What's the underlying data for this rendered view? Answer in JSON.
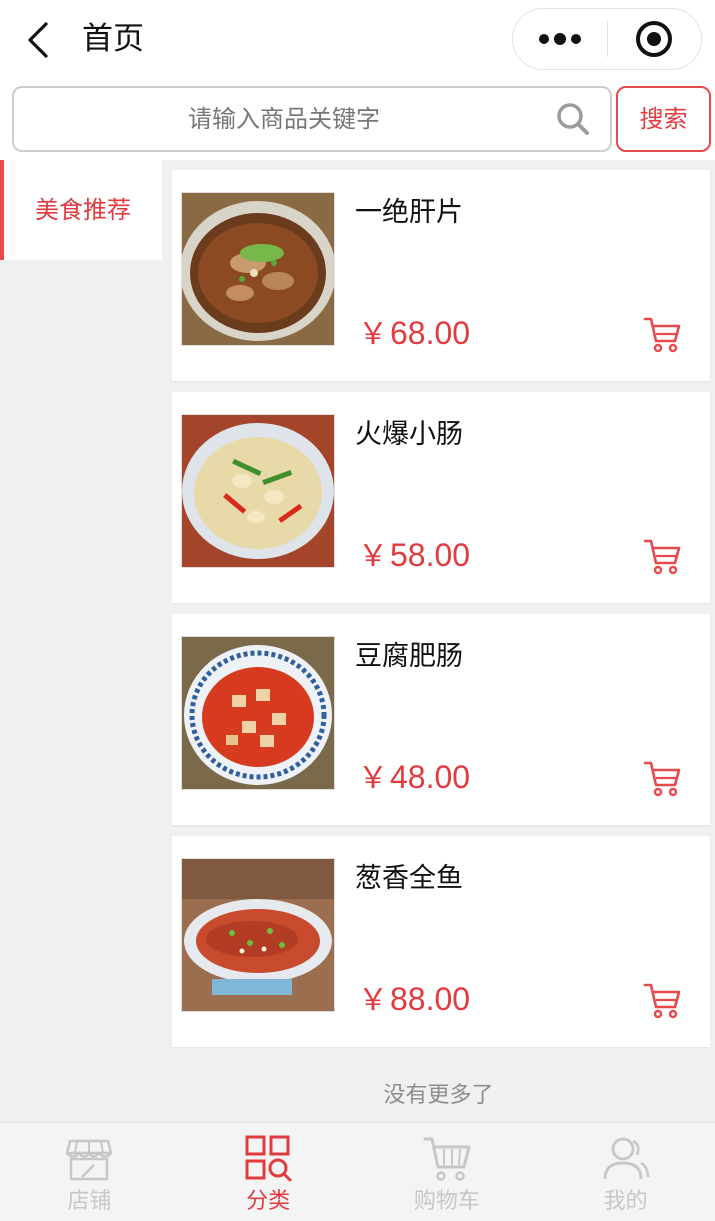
{
  "header": {
    "title": "首页",
    "back_icon": "chevron-left-icon",
    "more_icon": "more-dots-icon",
    "close_icon": "target-circle-icon"
  },
  "search": {
    "placeholder": "请输入商品关键字",
    "button_label": "搜索",
    "icon": "search-icon"
  },
  "sidebar": {
    "items": [
      {
        "label": "美食推荐",
        "active": true
      }
    ]
  },
  "products": [
    {
      "name": "一绝肝片",
      "currency": "￥",
      "price": "68.00",
      "cart_icon": "cart-icon"
    },
    {
      "name": "火爆小肠",
      "currency": "￥",
      "price": "58.00",
      "cart_icon": "cart-icon"
    },
    {
      "name": "豆腐肥肠",
      "currency": "￥",
      "price": "48.00",
      "cart_icon": "cart-icon"
    },
    {
      "name": "葱香全鱼",
      "currency": "￥",
      "price": "88.00",
      "cart_icon": "cart-icon"
    }
  ],
  "list_footer": "没有更多了",
  "tabbar": {
    "items": [
      {
        "label": "店铺",
        "icon": "store-icon",
        "active": false
      },
      {
        "label": "分类",
        "icon": "category-icon",
        "active": true
      },
      {
        "label": "购物车",
        "icon": "cart-icon",
        "active": false
      },
      {
        "label": "我的",
        "icon": "user-icon",
        "active": false
      }
    ]
  },
  "colors": {
    "accent": "#e23b3f",
    "background": "#f0f0f0",
    "inactive_tab": "#c7c7c7"
  }
}
